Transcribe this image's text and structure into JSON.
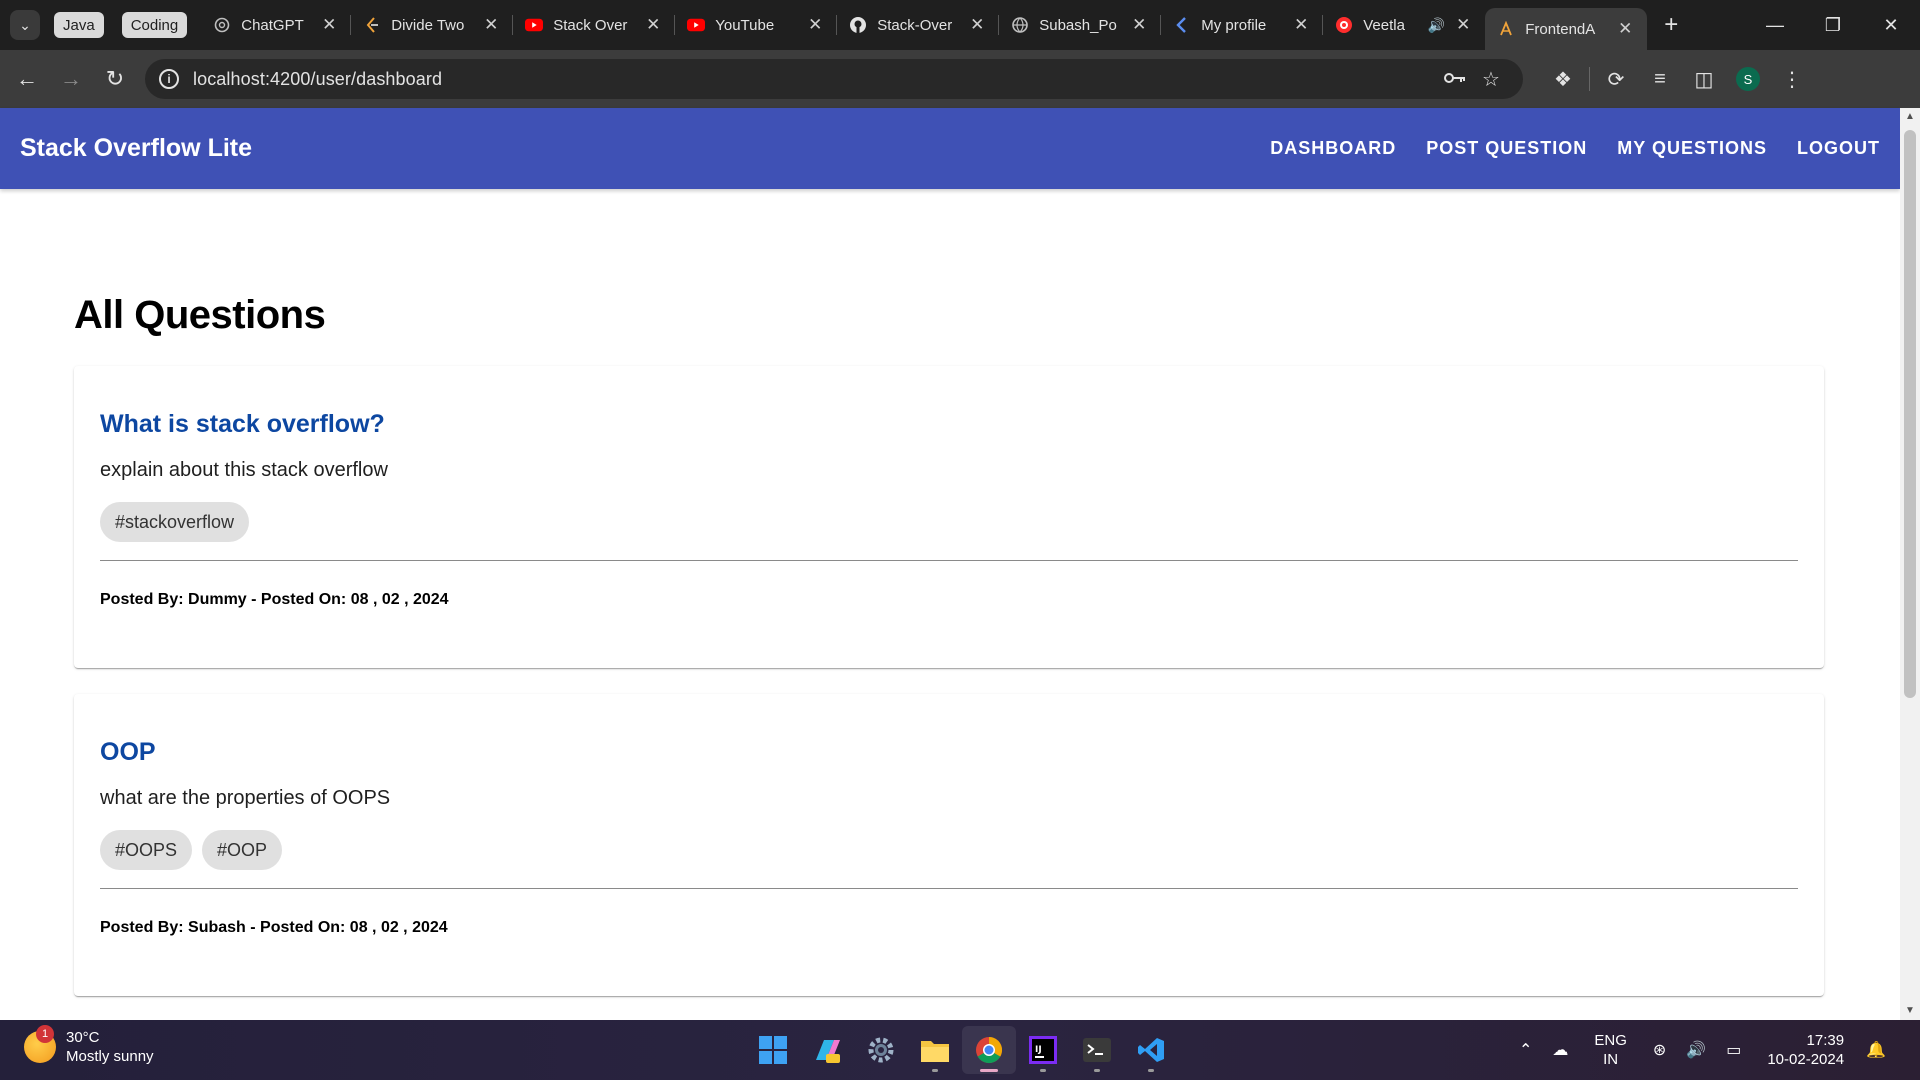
{
  "browser": {
    "tab_groups": [
      "Java",
      "Coding"
    ],
    "tabs": [
      {
        "title": "ChatGPT",
        "icon": "chatgpt-icon"
      },
      {
        "title": "Divide Two",
        "icon": "leetcode-icon"
      },
      {
        "title": "Stack Over",
        "icon": "youtube-icon"
      },
      {
        "title": "YouTube",
        "icon": "youtube-icon"
      },
      {
        "title": "Stack-Over",
        "icon": "github-icon"
      },
      {
        "title": "Subash_Po",
        "icon": "globe-icon"
      },
      {
        "title": "My profile",
        "icon": "profile-site-icon"
      },
      {
        "title": "Veetla",
        "icon": "record-icon",
        "audio": true
      },
      {
        "title": "FrontendA",
        "icon": "angular-icon",
        "active": true
      }
    ],
    "address": "localhost:4200/user/dashboard",
    "profile_initial": "S"
  },
  "app": {
    "brand": "Stack Overflow Lite",
    "nav": [
      "DASHBOARD",
      "POST QUESTION",
      "MY QUESTIONS",
      "LOGOUT"
    ],
    "page_title": "All Questions",
    "questions": [
      {
        "title": "What is stack overflow?",
        "body": "explain about this stack overflow",
        "tags": [
          "#stackoverflow"
        ],
        "meta": "Posted By: Dummy - Posted On: 08 , 02 , 2024"
      },
      {
        "title": "OOP",
        "body": "what are the properties of OOPS",
        "tags": [
          "#OOPS",
          "#OOP"
        ],
        "meta": "Posted By: Subash - Posted On: 08 , 02 , 2024"
      }
    ]
  },
  "taskbar": {
    "weather_temp": "30°C",
    "weather_desc": "Mostly sunny",
    "weather_badge": "1",
    "language": "ENG",
    "region": "IN",
    "time": "17:39",
    "date": "10-02-2024"
  },
  "colors": {
    "header": "#3f51b5",
    "question_title": "#0d47a1",
    "tag_bg": "#e0e0e0"
  }
}
